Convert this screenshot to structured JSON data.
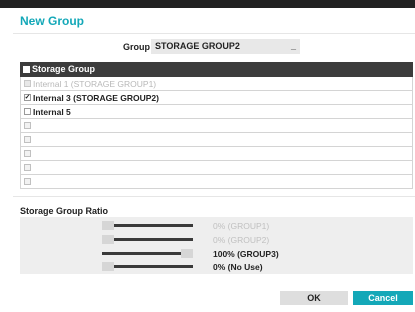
{
  "dialog": {
    "title": "New Group"
  },
  "group": {
    "label": "Group",
    "value": "STORAGE GROUP2",
    "dropdown_glyph": "_"
  },
  "storage_table": {
    "header": "Storage Group",
    "rows": [
      {
        "label": "Internal 1 (STORAGE GROUP1)",
        "checked": false,
        "disabled": true
      },
      {
        "label": "Internal 3 (STORAGE GROUP2)",
        "checked": true,
        "disabled": false
      },
      {
        "label": "Internal 5",
        "checked": false,
        "disabled": false
      },
      {
        "label": "",
        "checked": false,
        "disabled": false
      },
      {
        "label": "",
        "checked": false,
        "disabled": false
      },
      {
        "label": "",
        "checked": false,
        "disabled": false
      },
      {
        "label": "",
        "checked": false,
        "disabled": false
      },
      {
        "label": "",
        "checked": false,
        "disabled": false
      }
    ]
  },
  "ratio": {
    "title": "Storage Group Ratio",
    "items": [
      {
        "text": "0% (GROUP1)",
        "percent": 0,
        "active": false
      },
      {
        "text": "0% (GROUP2)",
        "percent": 0,
        "active": false
      },
      {
        "text": "100% (GROUP3)",
        "percent": 100,
        "active": true
      },
      {
        "text": "0% (No Use)",
        "percent": 0,
        "active": true
      }
    ]
  },
  "buttons": {
    "ok": "OK",
    "cancel": "Cancel"
  },
  "colors": {
    "accent": "#14a8b8",
    "header_bg": "#3c3c3c"
  }
}
